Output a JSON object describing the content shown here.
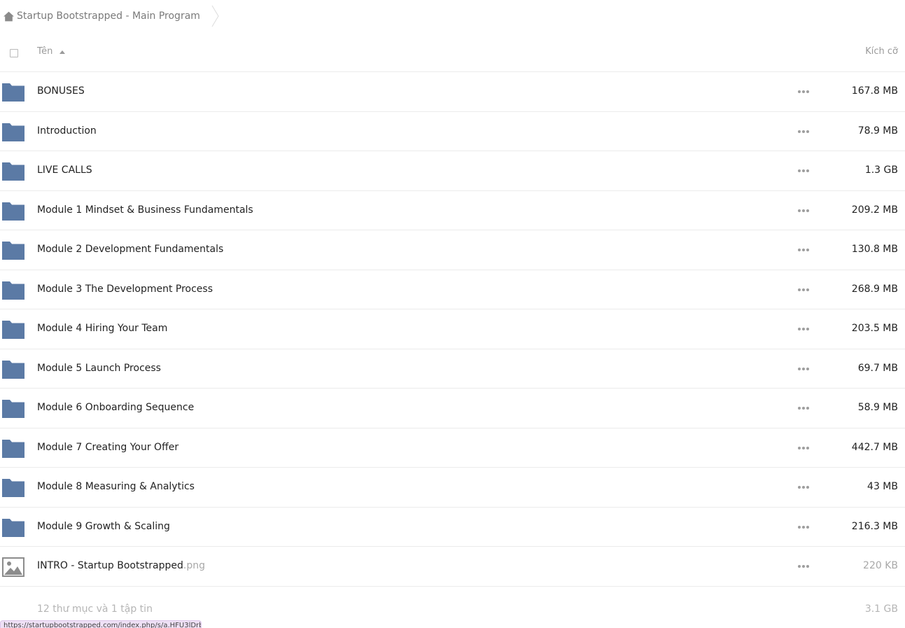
{
  "breadcrumb": {
    "home_icon": "home-icon",
    "label": "Startup Bootstrapped - Main Program"
  },
  "header": {
    "name_label": "Tên",
    "size_label": "Kích cỡ",
    "sort": "ascending"
  },
  "colors": {
    "folder": "#5b7aa5",
    "text": "#222222",
    "muted": "#9a9a9a",
    "divider": "#ebebeb",
    "status_bg": "#efe1f6"
  },
  "items": [
    {
      "type": "folder",
      "name": "BONUSES",
      "ext": "",
      "size": "167.8 MB"
    },
    {
      "type": "folder",
      "name": "Introduction",
      "ext": "",
      "size": "78.9 MB"
    },
    {
      "type": "folder",
      "name": "LIVE CALLS",
      "ext": "",
      "size": "1.3 GB"
    },
    {
      "type": "folder",
      "name": "Module 1 Mindset & Business Fundamentals",
      "ext": "",
      "size": "209.2 MB"
    },
    {
      "type": "folder",
      "name": "Module 2 Development Fundamentals",
      "ext": "",
      "size": "130.8 MB"
    },
    {
      "type": "folder",
      "name": "Module 3 The Development Process",
      "ext": "",
      "size": "268.9 MB"
    },
    {
      "type": "folder",
      "name": "Module 4 Hiring Your Team",
      "ext": "",
      "size": "203.5 MB"
    },
    {
      "type": "folder",
      "name": "Module 5 Launch Process",
      "ext": "",
      "size": "69.7 MB"
    },
    {
      "type": "folder",
      "name": "Module 6 Onboarding Sequence",
      "ext": "",
      "size": "58.9 MB"
    },
    {
      "type": "folder",
      "name": "Module 7 Creating Your Offer",
      "ext": "",
      "size": "442.7 MB"
    },
    {
      "type": "folder",
      "name": "Module 8 Measuring & Analytics",
      "ext": "",
      "size": "43 MB"
    },
    {
      "type": "folder",
      "name": "Module 9 Growth & Scaling",
      "ext": "",
      "size": "216.3 MB"
    },
    {
      "type": "image",
      "name": "INTRO - Startup Bootstrapped",
      "ext": ".png",
      "size": "220 KB"
    }
  ],
  "summary": {
    "count_text": "12 thư mục và 1 tập tin",
    "total_size": "3.1 GB"
  },
  "status_bar": {
    "url": "https://startupbootstrapped.com/index.php/s/a.HFU3lDrbJME_9"
  }
}
